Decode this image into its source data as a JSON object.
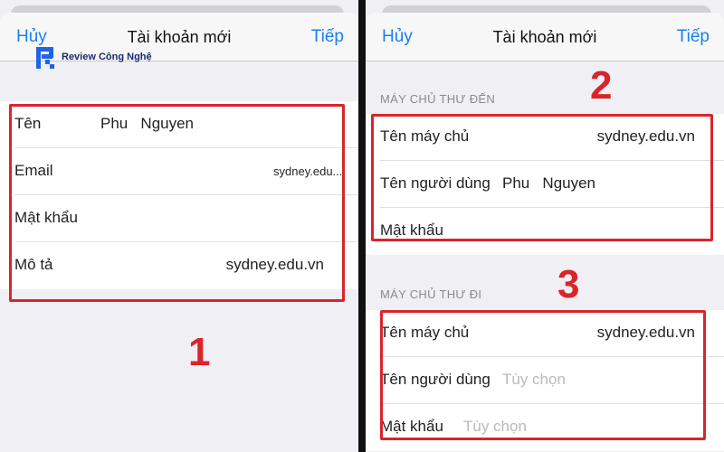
{
  "logo": {
    "text": "Review Công Nghệ"
  },
  "colors": {
    "ios_blue": "#1a7ff0",
    "annotation_red": "#d9252a",
    "placeholder_gray": "#b9b9be"
  },
  "left_screen": {
    "nav": {
      "cancel": "Hủy",
      "title": "Tài khoản mới",
      "next": "Tiếp"
    },
    "rows": [
      {
        "label": "Tên",
        "value": "Phu   Nguyen"
      },
      {
        "label": "Email",
        "value": "sydney.edu...."
      },
      {
        "label": "Mật khẩu",
        "value": ""
      },
      {
        "label": "Mô tả",
        "value": "sydney.edu.vn"
      }
    ],
    "annotation": "1"
  },
  "right_screen": {
    "nav": {
      "cancel": "Hủy",
      "title": "Tài khoản mới",
      "next": "Tiếp"
    },
    "incoming": {
      "header": "MÁY CHỦ THƯ ĐẾN",
      "rows": [
        {
          "label": "Tên máy chủ",
          "value": "sydney.edu.vn"
        },
        {
          "label": "Tên người dùng",
          "value": "Phu   Nguyen"
        },
        {
          "label": "Mật khẩu",
          "value": ""
        }
      ],
      "annotation": "2"
    },
    "outgoing": {
      "header": "MÁY CHỦ THƯ ĐI",
      "rows": [
        {
          "label": "Tên máy chủ",
          "value": "sydney.edu.vn"
        },
        {
          "label": "Tên người dùng",
          "placeholder": "Tùy chọn"
        },
        {
          "label": "Mật khẩu",
          "placeholder": "Tùy chọn"
        }
      ],
      "annotation": "3"
    }
  }
}
